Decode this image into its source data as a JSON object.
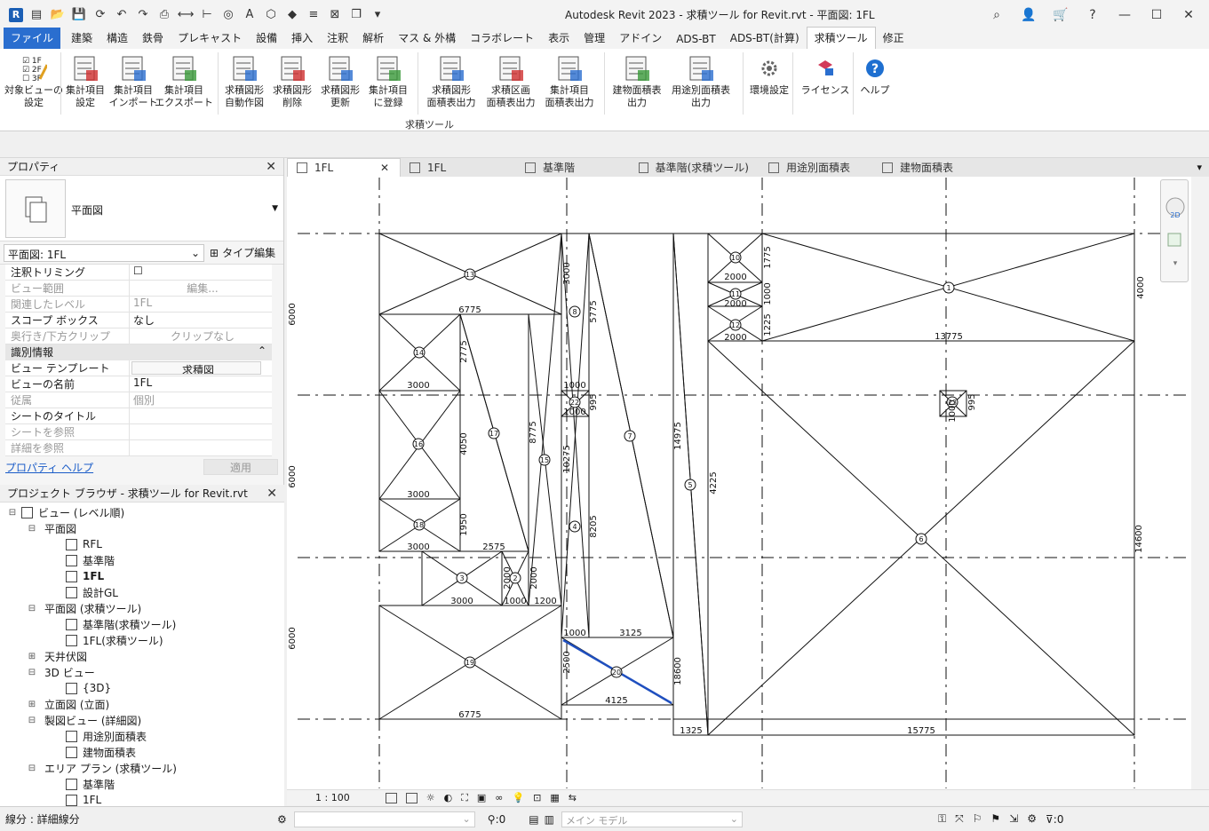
{
  "title": "Autodesk Revit 2023 - 求積ツール for Revit.rvt - 平面図: 1FL",
  "menu": [
    "ファイル",
    "建築",
    "構造",
    "鉄骨",
    "プレキャスト",
    "設備",
    "挿入",
    "注釈",
    "解析",
    "マス & 外構",
    "コラボレート",
    "表示",
    "管理",
    "アドイン",
    "ADS-BT",
    "ADS-BT(計算)",
    "求積ツール",
    "修正"
  ],
  "ribbon": {
    "buttons": [
      {
        "l1": "対象ビューの",
        "l2": "設定"
      },
      {
        "l1": "集計項目",
        "l2": "設定"
      },
      {
        "l1": "集計項目",
        "l2": "インポート"
      },
      {
        "l1": "集計項目",
        "l2": "エクスポート"
      },
      {
        "l1": "求積図形",
        "l2": "自動作図"
      },
      {
        "l1": "求積図形",
        "l2": "削除"
      },
      {
        "l1": "求積図形",
        "l2": "更新"
      },
      {
        "l1": "集計項目",
        "l2": "に登録"
      },
      {
        "l1": "求積図形",
        "l2": "面積表出力"
      },
      {
        "l1": "求積区画",
        "l2": "面積表出力"
      },
      {
        "l1": "集計項目",
        "l2": "面積表出力"
      },
      {
        "l1": "建物面積表",
        "l2": "出力"
      },
      {
        "l1": "用途別面積表",
        "l2": "出力"
      },
      {
        "l1": "環境設定",
        "l2": ""
      },
      {
        "l1": "ライセンス",
        "l2": ""
      },
      {
        "l1": "ヘルプ",
        "l2": ""
      }
    ],
    "panel_label": "求積ツール",
    "icon_lines": [
      "1F",
      "2F",
      "3F"
    ]
  },
  "properties": {
    "header": "プロパティ",
    "type_name": "平面図",
    "view_select": "平面図: 1FL",
    "type_edit": "タイプ編集",
    "rows": [
      {
        "k": "注釈トリミング",
        "v": "☐",
        "dim": false
      },
      {
        "k": "ビュー範囲",
        "v": "編集...",
        "dim": true
      },
      {
        "k": "関連したレベル",
        "v": "1FL",
        "dim": true
      },
      {
        "k": "スコープ ボックス",
        "v": "なし",
        "dim": false
      },
      {
        "k": "奥行き/下方クリップ",
        "v": "クリップなし",
        "dim": true
      }
    ],
    "group": "識別情報",
    "rows2": [
      {
        "k": "ビュー テンプレート",
        "v": "求積図",
        "dim": false
      },
      {
        "k": "ビューの名前",
        "v": "1FL",
        "dim": false
      },
      {
        "k": "従属",
        "v": "個別",
        "dim": true
      },
      {
        "k": "シートのタイトル",
        "v": "",
        "dim": false
      },
      {
        "k": "シートを参照",
        "v": "",
        "dim": true
      },
      {
        "k": "詳細を参照",
        "v": "",
        "dim": true
      }
    ],
    "help": "プロパティ ヘルプ",
    "apply": "適用"
  },
  "browser": {
    "header": "プロジェクト ブラウザ - 求積ツール for Revit.rvt",
    "items": [
      {
        "t": "ビュー (レベル順)",
        "lvl": 0,
        "exp": "⊟",
        "ico": true
      },
      {
        "t": "平面図",
        "lvl": 1,
        "exp": "⊟",
        "ico": false
      },
      {
        "t": "RFL",
        "lvl": 2,
        "exp": "",
        "ico": true
      },
      {
        "t": "基準階",
        "lvl": 2,
        "exp": "",
        "ico": true
      },
      {
        "t": "1FL",
        "lvl": 2,
        "exp": "",
        "ico": true,
        "bold": true
      },
      {
        "t": "設計GL",
        "lvl": 2,
        "exp": "",
        "ico": true
      },
      {
        "t": "平面図 (求積ツール)",
        "lvl": 1,
        "exp": "⊟",
        "ico": false
      },
      {
        "t": "基準階(求積ツール)",
        "lvl": 2,
        "exp": "",
        "ico": true
      },
      {
        "t": "1FL(求積ツール)",
        "lvl": 2,
        "exp": "",
        "ico": true
      },
      {
        "t": "天井伏図",
        "lvl": 1,
        "exp": "⊞",
        "ico": false
      },
      {
        "t": "3D ビュー",
        "lvl": 1,
        "exp": "⊟",
        "ico": false
      },
      {
        "t": "{3D}",
        "lvl": 2,
        "exp": "",
        "ico": true
      },
      {
        "t": "立面図 (立面)",
        "lvl": 1,
        "exp": "⊞",
        "ico": false
      },
      {
        "t": "製図ビュー (詳細図)",
        "lvl": 1,
        "exp": "⊟",
        "ico": false
      },
      {
        "t": "用途別面積表",
        "lvl": 2,
        "exp": "",
        "ico": true
      },
      {
        "t": "建物面積表",
        "lvl": 2,
        "exp": "",
        "ico": true
      },
      {
        "t": "エリア プラン (求積ツール)",
        "lvl": 1,
        "exp": "⊟",
        "ico": false
      },
      {
        "t": "基準階",
        "lvl": 2,
        "exp": "",
        "ico": true
      },
      {
        "t": "1FL",
        "lvl": 2,
        "exp": "",
        "ico": true
      }
    ]
  },
  "tabs": [
    {
      "label": "1FL",
      "active": true
    },
    {
      "label": "1FL",
      "active": false
    },
    {
      "label": "基準階",
      "active": false
    },
    {
      "label": "基準階(求積ツール)",
      "active": false
    },
    {
      "label": "用途別面積表",
      "active": false
    },
    {
      "label": "建物面積表",
      "active": false
    }
  ],
  "viewbar": {
    "scale": "1 : 100"
  },
  "statusbar": {
    "left": "線分 : 詳細線分",
    "count": ":0",
    "model": "メイン モデル",
    "filter": ":0"
  },
  "drawing": {
    "dims": [
      "6775",
      "3000",
      "3000",
      "3000",
      "2575",
      "3000",
      "1000",
      "1200",
      "6775",
      "4125",
      "3125",
      "1000",
      "1000",
      "1000",
      "2000",
      "2000",
      "2000",
      "13775",
      "1325",
      "15775",
      "2775",
      "4050",
      "1950",
      "8775",
      "10275",
      "2000",
      "2000",
      "3000",
      "5775",
      "995",
      "8205",
      "14975",
      "4225",
      "2500",
      "18600",
      "1775",
      "1000",
      "1225",
      "4000",
      "14600",
      "995",
      "1000",
      "6000",
      "6000",
      "6000"
    ],
    "labels": [
      "13",
      "14",
      "16",
      "18",
      "15",
      "17",
      "3",
      "2",
      "19",
      "20",
      "1",
      "22",
      "4",
      "7",
      "5",
      "10",
      "11",
      "12",
      "8",
      "6",
      "23"
    ]
  },
  "colors": {
    "accent": "#2a6ecf",
    "selection": "#1f4fbf"
  }
}
